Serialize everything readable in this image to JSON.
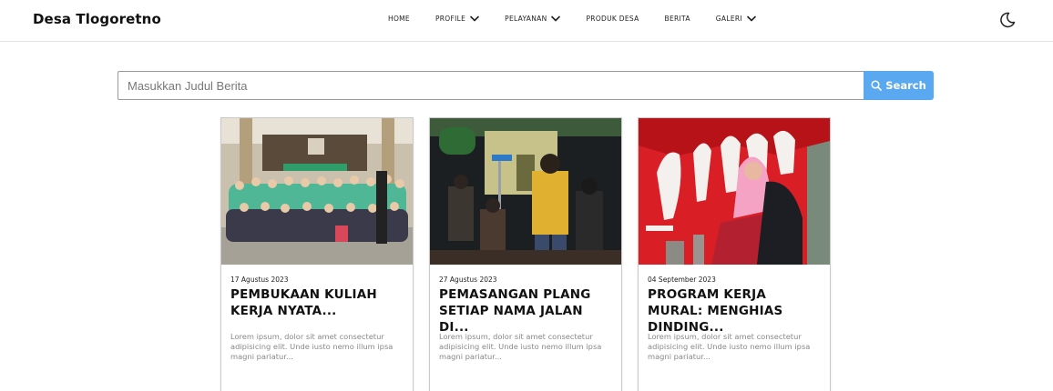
{
  "brand": "Desa Tlogoretno",
  "nav": [
    {
      "label": "HOME",
      "dropdown": false
    },
    {
      "label": "PROFILE",
      "dropdown": true
    },
    {
      "label": "PELAYANAN",
      "dropdown": true
    },
    {
      "label": "PRODUK DESA",
      "dropdown": false
    },
    {
      "label": "BERITA",
      "dropdown": false
    },
    {
      "label": "GALERI",
      "dropdown": true
    }
  ],
  "theme_toggle_icon": "moon-icon",
  "search": {
    "placeholder": "Masukkan Judul Berita",
    "button_label": "Search",
    "button_color": "#5aa9f0"
  },
  "cards": [
    {
      "date": "17 Agustus 2023",
      "title": "PEMBUKAAN KULIAH KERJA NYATA...",
      "desc": "Lorem ipsum, dolor sit amet consectetur adipisicing elit. Unde iusto nemo illum ipsa magni pariatur..."
    },
    {
      "date": "27 Agustus 2023",
      "title": "PEMASANGAN PLANG SETIAP NAMA JALAN DI...",
      "desc": "Lorem ipsum, dolor sit amet consectetur adipisicing elit. Unde iusto nemo illum ipsa magni pariatur..."
    },
    {
      "date": "04 September 2023",
      "title": "PROGRAM KERJA MURAL: MENGHIAS DINDING...",
      "desc": "Lorem ipsum, dolor sit amet consectetur adipisicing elit. Unde iusto nemo illum ipsa magni pariatur..."
    }
  ]
}
